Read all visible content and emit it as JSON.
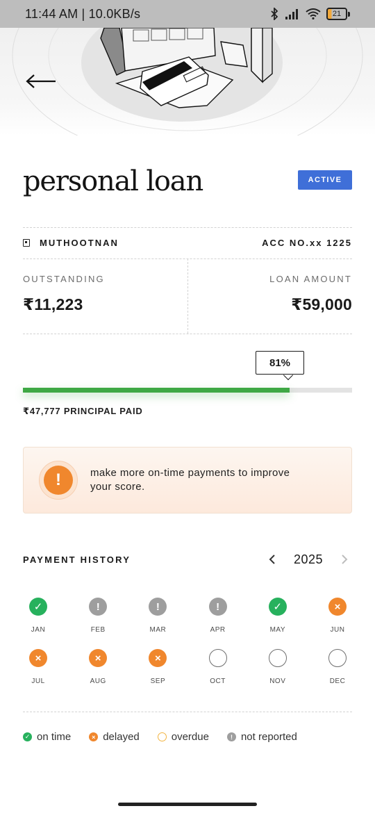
{
  "status_bar": {
    "time_speed": "11:44 AM | 10.0KB/s",
    "battery_level": "21",
    "icons": [
      "bluetooth-icon",
      "signal-icon",
      "wifi-icon",
      "battery-icon"
    ]
  },
  "header": {
    "back_icon": "arrow-left-icon"
  },
  "loan": {
    "title": "personal loan",
    "status": "ACTIVE",
    "lender": "MUTHOOTNAN",
    "account": "ACC NO.xx 1225",
    "outstanding_label": "OUTSTANDING",
    "outstanding_value": "₹11,223",
    "loan_amount_label": "LOAN AMOUNT",
    "loan_amount_value": "₹59,000",
    "progress_text": "81%",
    "progress_fraction": 0.81,
    "principal_paid": "₹47,777 PRINCIPAL PAID"
  },
  "tip": {
    "icon": "warning-icon",
    "text": "make more on-time payments to improve your score."
  },
  "payment_history": {
    "title": "PAYMENT HISTORY",
    "year": "2025",
    "months": [
      {
        "label": "JAN",
        "status": "on_time"
      },
      {
        "label": "FEB",
        "status": "not_reported"
      },
      {
        "label": "MAR",
        "status": "not_reported"
      },
      {
        "label": "APR",
        "status": "not_reported"
      },
      {
        "label": "MAY",
        "status": "on_time"
      },
      {
        "label": "JUN",
        "status": "delayed"
      },
      {
        "label": "JUL",
        "status": "delayed"
      },
      {
        "label": "AUG",
        "status": "delayed"
      },
      {
        "label": "SEP",
        "status": "delayed"
      },
      {
        "label": "OCT",
        "status": "empty"
      },
      {
        "label": "NOV",
        "status": "empty"
      },
      {
        "label": "DEC",
        "status": "empty"
      }
    ]
  },
  "legend": {
    "on_time": "on time",
    "delayed": "delayed",
    "overdue": "overdue",
    "not_reported": "not reported"
  },
  "colors": {
    "on_time": "#27b15d",
    "delayed": "#f0872d",
    "overdue": "#f2b441",
    "not_reported": "#9e9e9e",
    "active_badge": "#3f6fd8",
    "progress": "#3fa845"
  }
}
